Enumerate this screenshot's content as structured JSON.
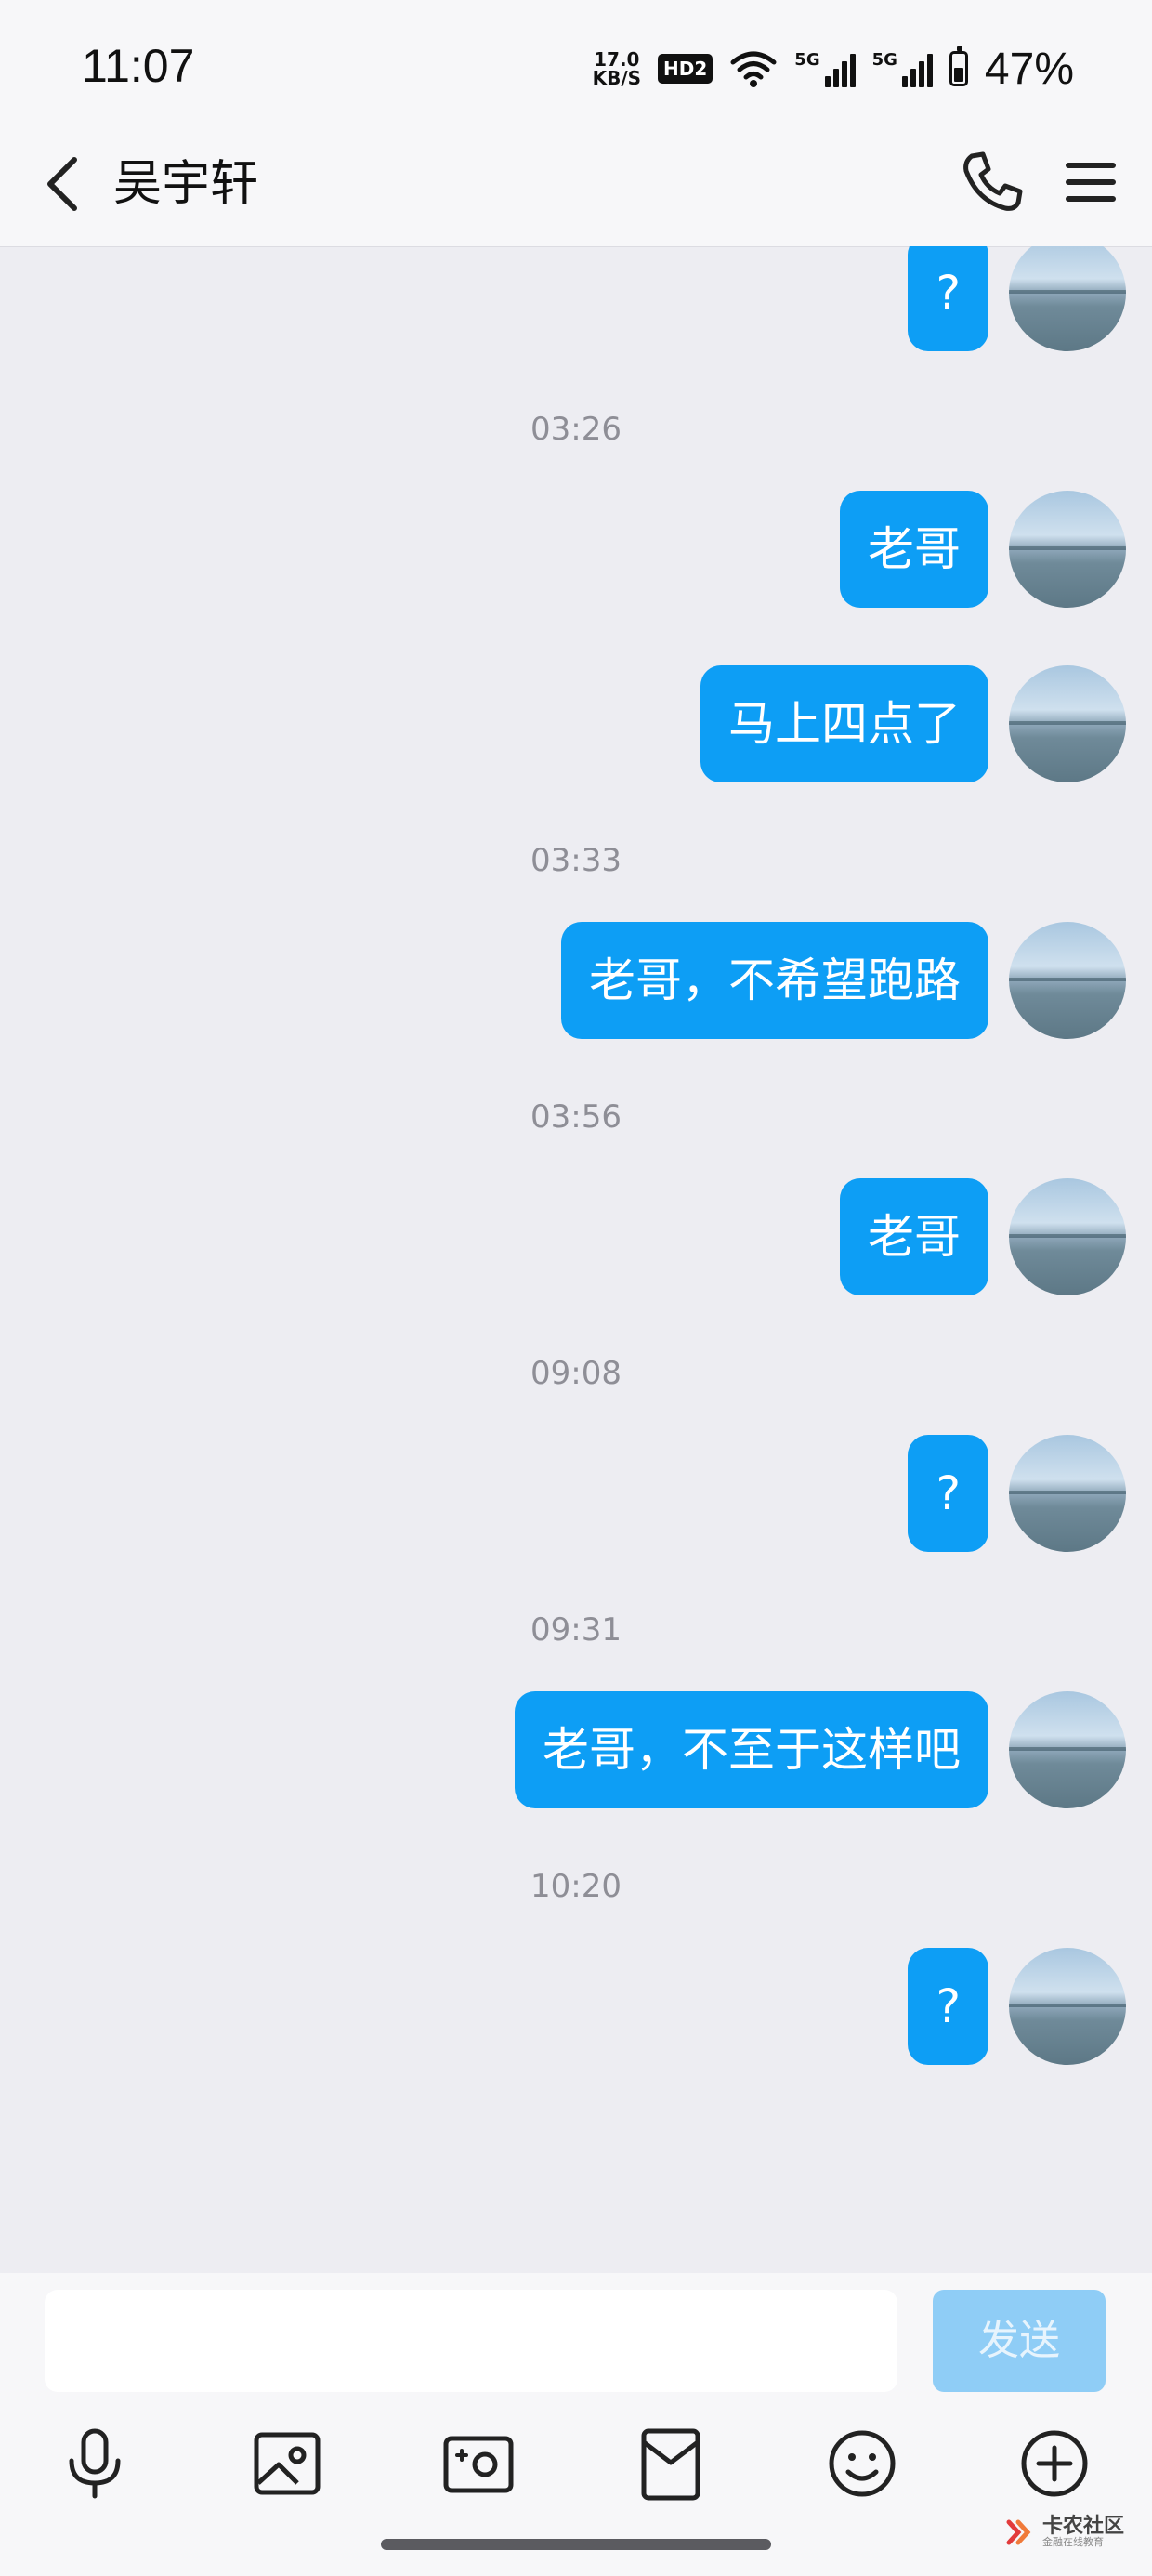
{
  "status_bar": {
    "time": "11:07",
    "net_speed_value": "17.0",
    "net_speed_unit": "KB/S",
    "hd_badge": "HD2",
    "signal_1_label": "5G",
    "signal_2_label": "5G",
    "battery_percent": "47%",
    "battery_level": 0.47
  },
  "header": {
    "title": "吴宇轩",
    "back_icon": "chevron-left-icon",
    "call_icon": "phone-icon",
    "menu_icon": "hamburger-menu-icon"
  },
  "chat": {
    "items": [
      {
        "type": "message",
        "text": "?"
      },
      {
        "type": "timestamp",
        "text": "03:26"
      },
      {
        "type": "message",
        "text": "老哥"
      },
      {
        "type": "message",
        "text": "马上四点了"
      },
      {
        "type": "timestamp",
        "text": "03:33"
      },
      {
        "type": "message",
        "text": "老哥，不希望跑路"
      },
      {
        "type": "timestamp",
        "text": "03:56"
      },
      {
        "type": "message",
        "text": "老哥"
      },
      {
        "type": "timestamp",
        "text": "09:08"
      },
      {
        "type": "message",
        "text": "?"
      },
      {
        "type": "timestamp",
        "text": "09:31"
      },
      {
        "type": "message",
        "text": "老哥，不至于这样吧"
      },
      {
        "type": "timestamp",
        "text": "10:20"
      },
      {
        "type": "message",
        "text": "?"
      }
    ]
  },
  "input": {
    "value": "",
    "send_label": "发送"
  },
  "toolbar": {
    "icons": [
      "microphone-icon",
      "image-icon",
      "camera-icon",
      "red-packet-icon",
      "emoji-icon",
      "plus-circle-icon"
    ]
  },
  "watermark": {
    "main": "卡农社区",
    "sub": "金融在线教育"
  },
  "colors": {
    "bubble": "#0d9ef5",
    "chat_background": "#ededf2",
    "send_button_disabled": "#8fcdf6"
  }
}
